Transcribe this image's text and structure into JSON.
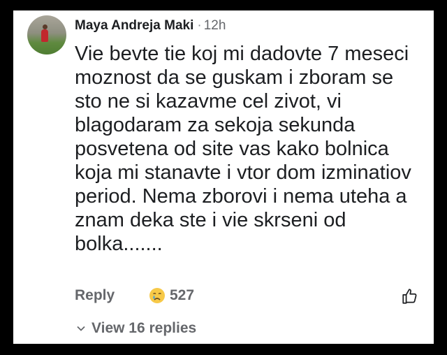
{
  "comment": {
    "author": "Maya Andreja Maki",
    "separator": "·",
    "time": "12h",
    "text": "Vie bevte tie koj mi dadovte 7 meseci moznost da se guskam i zboram se sto ne si kazavme cel zivot, vi blagodaram za sekoja sekunda posvetena od site vas kako bolnica koja mi stanavte i vtor dom izminatiov period. Nema zborovi i nema uteha a znam deka ste i vie skrseni od bolka.......",
    "reply_label": "Reply",
    "reaction_icon": "crying-face-icon",
    "reaction_count": "527",
    "like_icon": "thumbs-up-icon",
    "view_replies_label": "View 16 replies"
  },
  "colors": {
    "background": "#000000",
    "card": "#ffffff",
    "text": "#1c1e21",
    "muted": "#65676b"
  }
}
